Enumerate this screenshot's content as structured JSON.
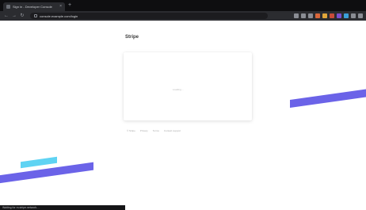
{
  "browser": {
    "tab": {
      "title": "Sign in - Developer Console",
      "close": "×"
    },
    "new_tab": "+",
    "nav": {
      "back": "←",
      "forward": "→",
      "reload": "↻"
    },
    "address": {
      "url": "console.example.com/login"
    },
    "extension_colors": [
      "#8a8d94",
      "#8a8d94",
      "#8a8d94",
      "#d9663a",
      "#e0a63a",
      "#c84b3a",
      "#7a4fd0",
      "#3aa0d9",
      "#8a8d94",
      "#8a8d94"
    ]
  },
  "page": {
    "title": "Stripe",
    "card": {
      "loading_text": "Loading…"
    },
    "footer": {
      "links": [
        "© Stripe",
        "Privacy",
        "Terms",
        "Contact support"
      ]
    },
    "accent_colors": {
      "purple": "#6b63e8",
      "cyan": "#5fd3f3"
    }
  },
  "status": {
    "text": "Waiting for m.stripe.network…"
  }
}
